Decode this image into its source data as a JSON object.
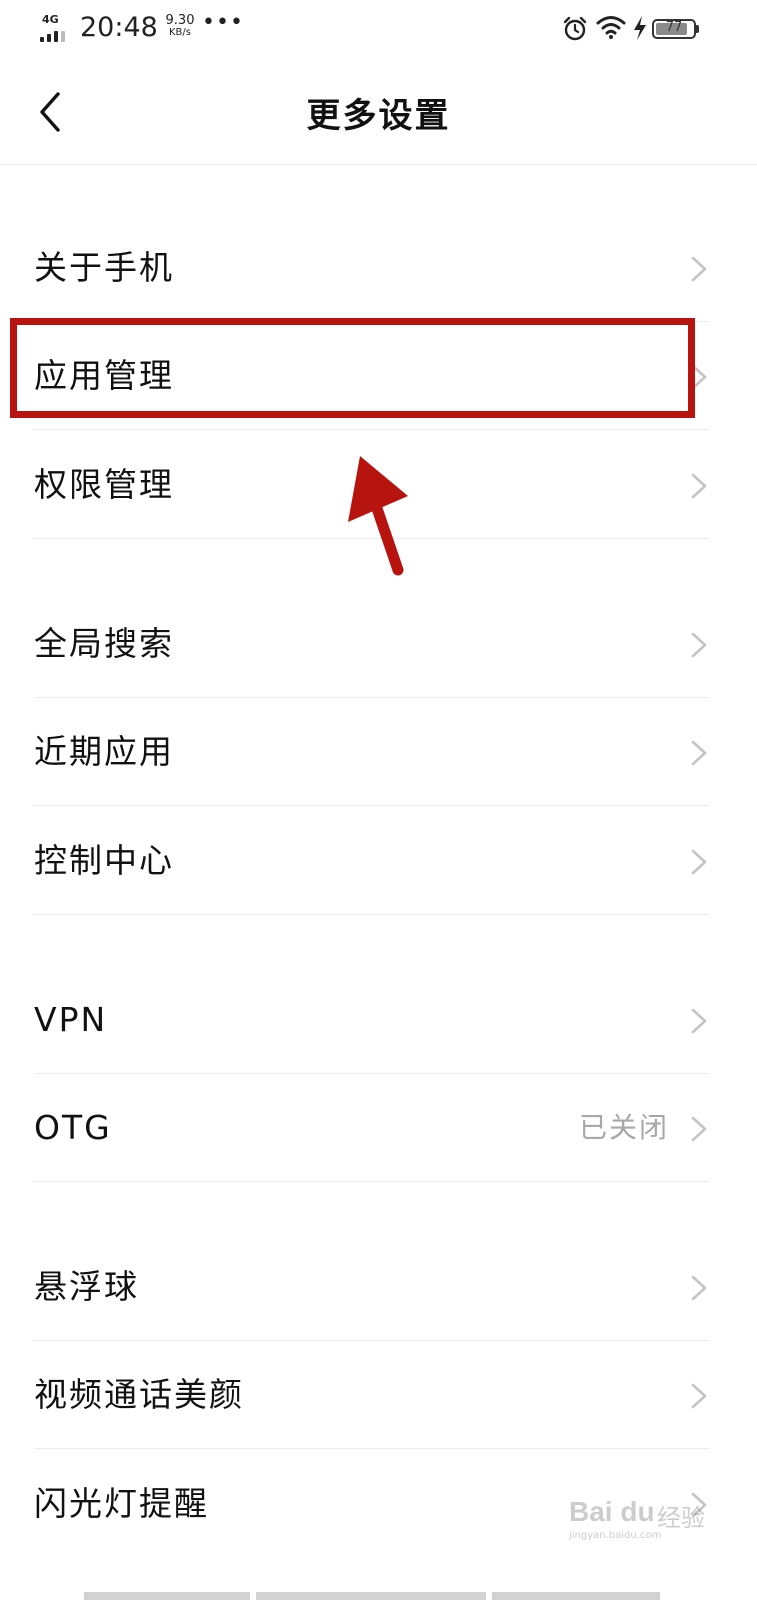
{
  "status_bar": {
    "network": "4G",
    "time": "20:48",
    "speed_value": "9.30",
    "speed_unit": "KB/s",
    "more": "•••",
    "battery": "77"
  },
  "header": {
    "title": "更多设置",
    "back_icon": "chevron-left-icon"
  },
  "list": {
    "items": [
      {
        "label": "关于手机",
        "value": ""
      },
      {
        "label": "应用管理",
        "value": ""
      },
      {
        "label": "权限管理",
        "value": ""
      },
      {
        "label": "全局搜索",
        "value": ""
      },
      {
        "label": "近期应用",
        "value": ""
      },
      {
        "label": "控制中心",
        "value": ""
      },
      {
        "label": "VPN",
        "value": ""
      },
      {
        "label": "OTG",
        "value": "已关闭"
      },
      {
        "label": "悬浮球",
        "value": ""
      },
      {
        "label": "视频通话美颜",
        "value": ""
      },
      {
        "label": "闪光灯提醒",
        "value": ""
      }
    ],
    "chevron_icon": "chevron-right-icon"
  },
  "annotation": {
    "highlight_color": "#b7140f",
    "highlighted_item": "应用管理"
  },
  "watermark": {
    "logo": "Bai du",
    "text": "经验",
    "domain": "jingyan.baidu.com"
  },
  "colors": {
    "text": "#111111",
    "secondary_text": "#a8a8a8",
    "divider": "#ececec",
    "chevron": "#c4c4c4",
    "accent_red": "#b7140f"
  }
}
